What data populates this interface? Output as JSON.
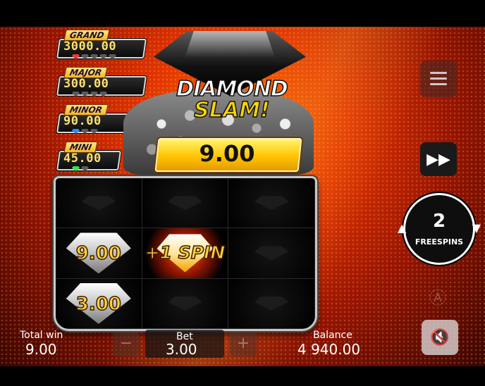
{
  "jackpots": [
    {
      "label": "GRAND",
      "value": "3000.00",
      "color": "#ff3030"
    },
    {
      "label": "MAJOR",
      "value": "300.00",
      "color": "#2a8bff"
    },
    {
      "label": "MINOR",
      "value": "90.00",
      "color": "#2a8bff"
    },
    {
      "label": "MINI",
      "value": "45.00",
      "color": "#33e04c"
    }
  ],
  "logo": {
    "line1": "DIAMOND",
    "line2": "SLAM!"
  },
  "win_amount": "9.00",
  "reels": {
    "cell_1_0": "9.00",
    "cell_1_1": "+1 SPIN",
    "cell_2_0": "3.00"
  },
  "freespins": {
    "count": "2",
    "label": "FREESPINS"
  },
  "footer": {
    "total_win_label": "Total win",
    "total_win_value": "9.00",
    "bet_label": "Bet",
    "bet_value": "3.00",
    "bet_minus": "−",
    "bet_plus": "+",
    "balance_label": "Balance",
    "balance_value": "4 940.00"
  },
  "icons": {
    "menu": "hamburger-icon",
    "fast_forward": "fast-forward-icon",
    "autoplay": "autoplay-icon",
    "sound": "sound-muted-icon"
  },
  "colors": {
    "accent": "#ffd23a",
    "background": "#e23300"
  }
}
